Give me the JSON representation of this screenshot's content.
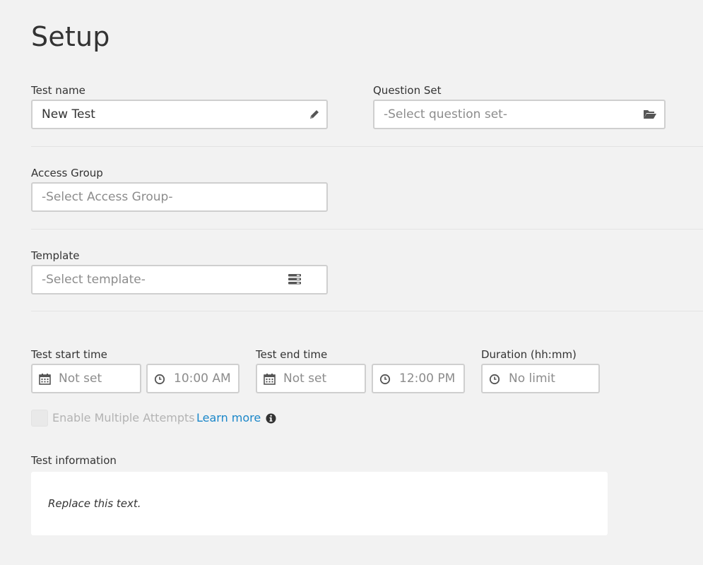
{
  "page": {
    "title": "Setup"
  },
  "test_name": {
    "label": "Test name",
    "value": "New Test",
    "icon": "pencil-icon"
  },
  "question_set": {
    "label": "Question Set",
    "placeholder": "-Select question set-",
    "icon": "folder-open-icon"
  },
  "access_group": {
    "label": "Access Group",
    "placeholder": "-Select Access Group-"
  },
  "template": {
    "label": "Template",
    "placeholder": "-Select template-",
    "icon": "template-list-icon"
  },
  "start": {
    "label": "Test start time",
    "date": "Not set",
    "time": "10:00 AM"
  },
  "end": {
    "label": "Test end time",
    "date": "Not set",
    "time": "12:00 PM"
  },
  "duration": {
    "label": "Duration (hh:mm)",
    "value": "No limit"
  },
  "attempts": {
    "label": "Enable Multiple Attempts",
    "learn_more": "Learn more",
    "checked": false
  },
  "info": {
    "label": "Test information",
    "text": "Replace this text."
  },
  "colors": {
    "background": "#f2f2f2",
    "link": "#1b87c9",
    "border": "#cfcfcf",
    "placeholder": "#8c8c8c"
  }
}
